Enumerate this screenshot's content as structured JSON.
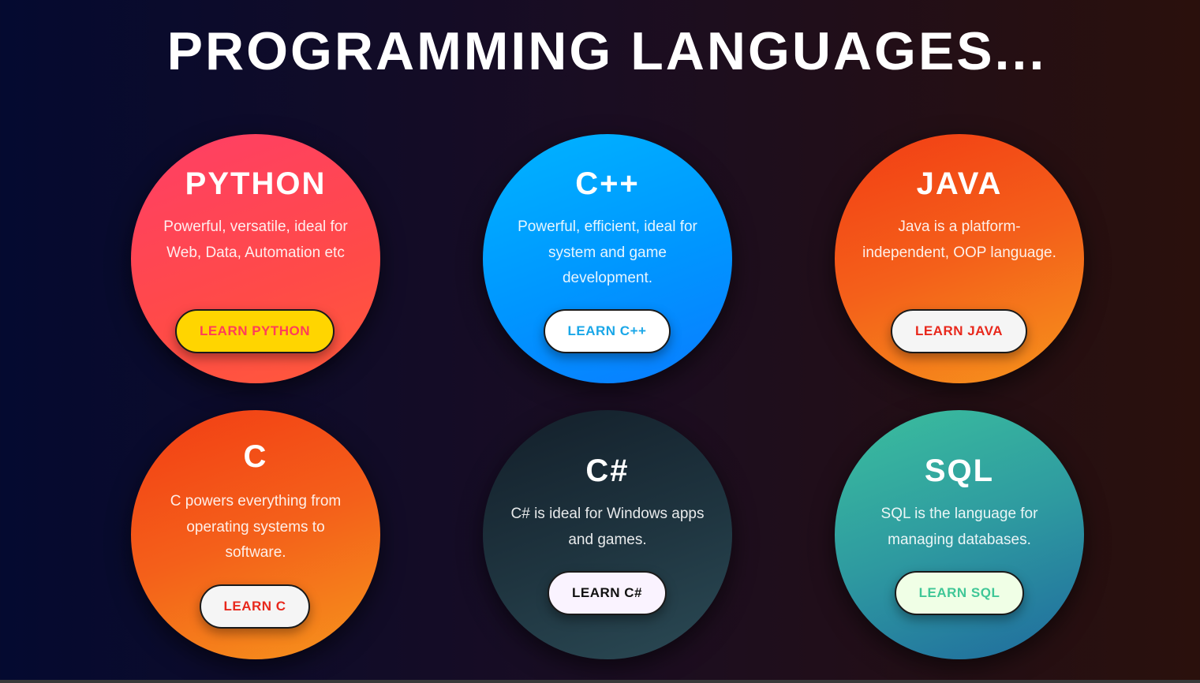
{
  "header": {
    "title": "PROGRAMMING LANGUAGES..."
  },
  "cards": [
    {
      "id": "python",
      "title": "PYTHON",
      "description": "Powerful, versatile, ideal for Web, Data, Automation etc",
      "button_label": "LEARN PYTHON"
    },
    {
      "id": "cpp",
      "title": "C++",
      "description": "Powerful, efficient, ideal for system and game development.",
      "button_label": "LEARN C++"
    },
    {
      "id": "java",
      "title": "JAVA",
      "description": "Java is a platform-independent, OOP language.",
      "button_label": "LEARN JAVA"
    },
    {
      "id": "c",
      "title": "C",
      "description": "C powers everything from operating systems to software.",
      "button_label": "LEARN C"
    },
    {
      "id": "csharp",
      "title": "C#",
      "description": "C# is ideal for Windows apps and games.",
      "button_label": "LEARN C#"
    },
    {
      "id": "sql",
      "title": "SQL",
      "description": "SQL is the language for managing databases.",
      "button_label": "LEARN SQL"
    }
  ],
  "colors": {
    "python_button_bg": "#ffd500",
    "python_button_text": "#ff3d5a",
    "cpp_button_text": "#1aa7e8",
    "java_button_text": "#e8281c",
    "c_button_text": "#e8281c",
    "csharp_button_text": "#111111",
    "sql_button_text": "#40c797"
  }
}
